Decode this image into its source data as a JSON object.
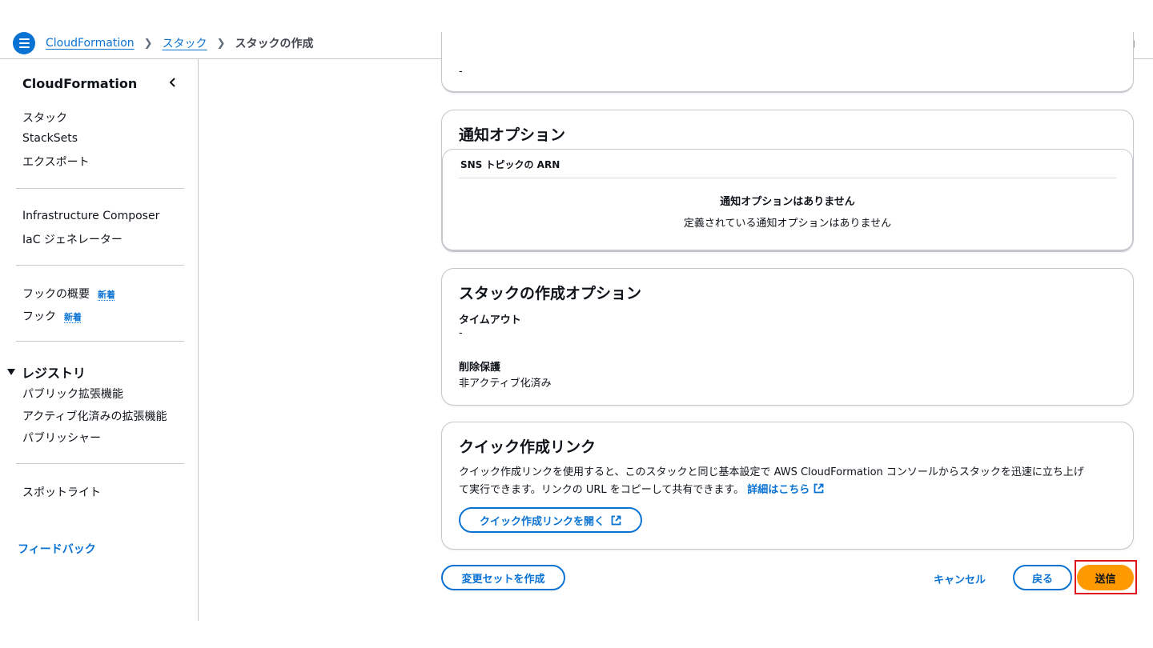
{
  "breadcrumb": {
    "items": [
      "CloudFormation",
      "スタック"
    ],
    "current": "スタックの作成"
  },
  "sidebar": {
    "title": "CloudFormation",
    "items_group1": [
      "スタック",
      "StackSets",
      "エクスポート"
    ],
    "items_group2": [
      "Infrastructure Composer",
      "IaC ジェネレーター"
    ],
    "items_group3": [
      {
        "label": "フックの概要",
        "badge": "新着"
      },
      {
        "label": "フック",
        "badge": "新着"
      }
    ],
    "registry": {
      "title": "レジストリ",
      "items": [
        "パブリック拡張機能",
        "アクティブ化済みの拡張機能",
        "パブリッシャー"
      ]
    },
    "spotlight": "スポットライト",
    "feedback": "フィードバック"
  },
  "top_card": {
    "value": "-"
  },
  "notification_card": {
    "title": "通知オプション",
    "table_header": "SNS トピックの ARN",
    "empty_title": "通知オプションはありません",
    "empty_desc": "定義されている通知オプションはありません"
  },
  "stack_options_card": {
    "title": "スタックの作成オプション",
    "timeout_label": "タイムアウト",
    "timeout_value": "-",
    "deletion_label": "削除保護",
    "deletion_value": "非アクティブ化済み"
  },
  "quick_link_card": {
    "title": "クイック作成リンク",
    "desc_line1": "クイック作成リンクを使用すると、このスタックと同じ基本設定で AWS CloudFormation コンソールからスタックを迅速に立ち上げ",
    "desc_line2": "て実行できます。リンクの URL をコピーして共有できます。",
    "learn_more": "詳細はこちら",
    "open_button": "クイック作成リンクを開く"
  },
  "actions": {
    "create_changeset": "変更セットを作成",
    "cancel": "キャンセル",
    "back": "戻る",
    "submit": "送信"
  },
  "colors": {
    "accent": "#0972d3",
    "primary": "#ff9900",
    "highlight": "#e0141e"
  }
}
